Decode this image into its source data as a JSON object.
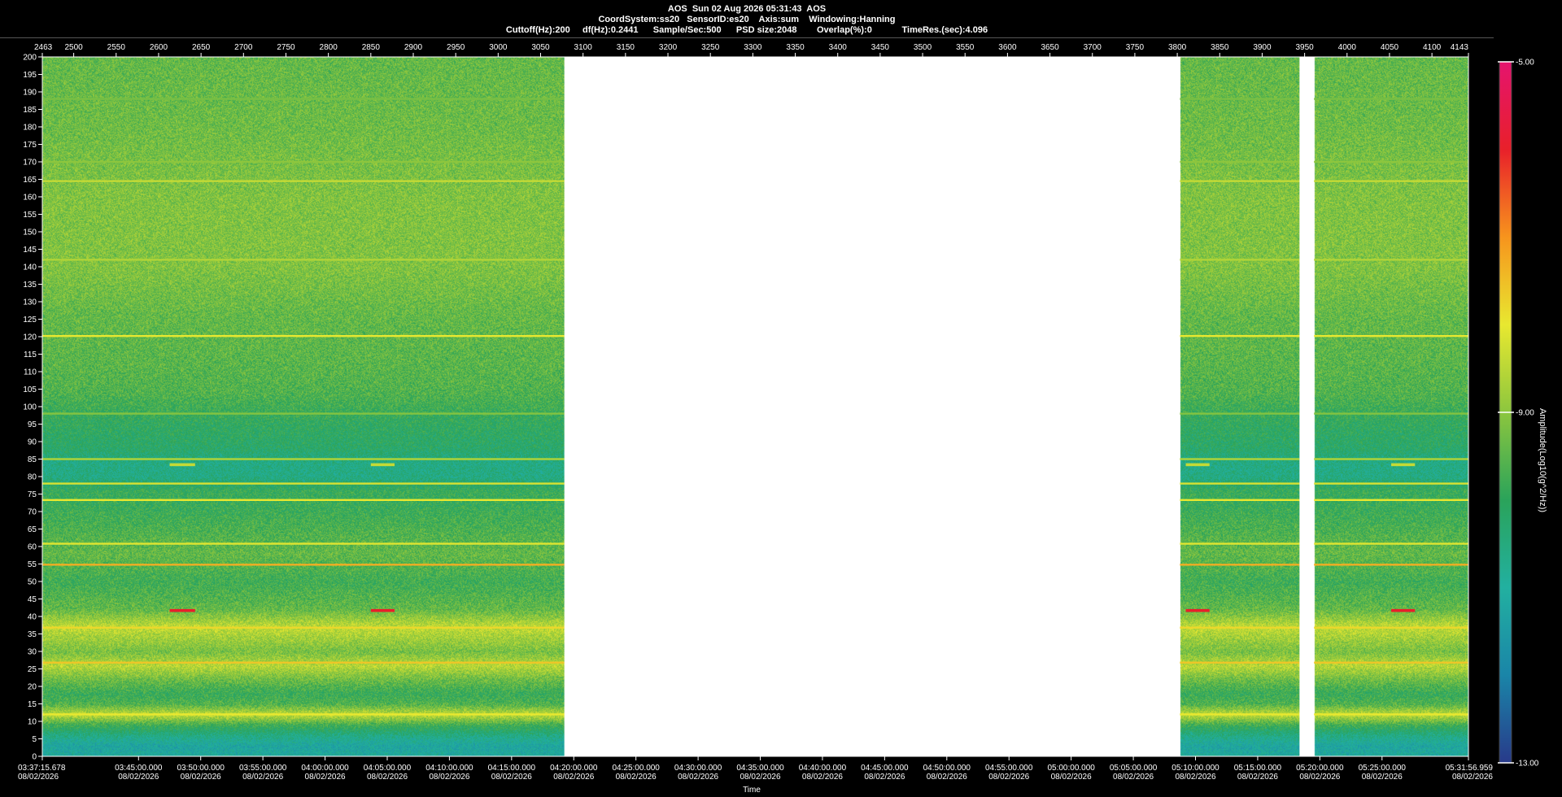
{
  "header": {
    "line1": "AOS  Sun 02 Aug 2026 05:31:43  AOS",
    "line2": "CoordSystem:ss20   SensorID:es20    Axis:sum    Windowing:Hanning",
    "line3": "Cuttoff(Hz):200     df(Hz):0.2441      Sample/Sec:500      PSD size:2048        Overlap(%):0            TimeRes.(sec):4.096"
  },
  "colors": {
    "background": "#000000",
    "gap": "#ffffff",
    "colormap": [
      "#283a8a",
      "#1a85a8",
      "#22b0a0",
      "#2aa35a",
      "#8cc63e",
      "#e8e830",
      "#f7941d",
      "#e8202a",
      "#e5146e"
    ]
  },
  "chart_data": {
    "type": "heatmap",
    "title": "AOS  Sun 02 Aug 2026 05:31:43  AOS",
    "xlabel": "Time",
    "ylabel": "",
    "colorbar": {
      "label": "Amplitude(Log10(g^2/Hz))",
      "range": [
        -13.0,
        -5.0
      ],
      "tick_labels": [
        "-5.00",
        "-9.00",
        "-13.00"
      ]
    },
    "y_range": [
      0,
      200
    ],
    "y_ticks": [
      0,
      5,
      10,
      15,
      20,
      25,
      30,
      35,
      40,
      45,
      50,
      55,
      60,
      65,
      70,
      75,
      80,
      85,
      90,
      95,
      100,
      105,
      110,
      115,
      120,
      125,
      130,
      135,
      140,
      145,
      150,
      155,
      160,
      165,
      170,
      175,
      180,
      185,
      190,
      195,
      200
    ],
    "top_x_range": [
      2463,
      4143
    ],
    "top_x_ticks": [
      2463,
      2500,
      2550,
      2600,
      2650,
      2700,
      2750,
      2800,
      2850,
      2900,
      2950,
      3000,
      3050,
      3100,
      3150,
      3200,
      3250,
      3300,
      3350,
      3400,
      3450,
      3500,
      3550,
      3600,
      3650,
      3700,
      3750,
      3800,
      3850,
      3900,
      3950,
      4000,
      4050,
      4100,
      4143
    ],
    "time_range": [
      "03:37:15.678",
      "05:31:56.959"
    ],
    "time_ticks": [
      {
        "time": "03:37:15.678",
        "date": "08/02/2026"
      },
      {
        "time": "03:45:00.000",
        "date": "08/02/2026"
      },
      {
        "time": "03:50:00.000",
        "date": "08/02/2026"
      },
      {
        "time": "03:55:00.000",
        "date": "08/02/2026"
      },
      {
        "time": "04:00:00.000",
        "date": "08/02/2026"
      },
      {
        "time": "04:05:00.000",
        "date": "08/02/2026"
      },
      {
        "time": "04:10:00.000",
        "date": "08/02/2026"
      },
      {
        "time": "04:15:00.000",
        "date": "08/02/2026"
      },
      {
        "time": "04:20:00.000",
        "date": "08/02/2026"
      },
      {
        "time": "04:25:00.000",
        "date": "08/02/2026"
      },
      {
        "time": "04:30:00.000",
        "date": "08/02/2026"
      },
      {
        "time": "04:35:00.000",
        "date": "08/02/2026"
      },
      {
        "time": "04:40:00.000",
        "date": "08/02/2026"
      },
      {
        "time": "04:45:00.000",
        "date": "08/02/2026"
      },
      {
        "time": "04:50:00.000",
        "date": "08/02/2026"
      },
      {
        "time": "04:55:00.000",
        "date": "08/02/2026"
      },
      {
        "time": "05:00:00.000",
        "date": "08/02/2026"
      },
      {
        "time": "05:05:00.000",
        "date": "08/02/2026"
      },
      {
        "time": "05:10:00.000",
        "date": "08/02/2026"
      },
      {
        "time": "05:15:00.000",
        "date": "08/02/2026"
      },
      {
        "time": "05:20:00.000",
        "date": "08/02/2026"
      },
      {
        "time": "05:25:00.000",
        "date": "08/02/2026"
      },
      {
        "time": "05:31:56.959",
        "date": "08/02/2026"
      }
    ],
    "data_segments": [
      {
        "start": 2463,
        "end": 3078
      },
      {
        "start": 3803,
        "end": 3944
      },
      {
        "start": 3961,
        "end": 4143
      }
    ],
    "gaps": [
      {
        "start": 3078,
        "end": 3803
      },
      {
        "start": 3944,
        "end": 3961
      }
    ],
    "base_level_profile": [
      {
        "f": 0,
        "level": -11.0
      },
      {
        "f": 3,
        "level": -11.2
      },
      {
        "f": 6,
        "level": -10.6
      },
      {
        "f": 9,
        "level": -9.8
      },
      {
        "f": 12,
        "level": -8.4
      },
      {
        "f": 15,
        "level": -9.6
      },
      {
        "f": 18,
        "level": -9.9
      },
      {
        "f": 22,
        "level": -9.3
      },
      {
        "f": 26,
        "level": -8.5
      },
      {
        "f": 30,
        "level": -9.2
      },
      {
        "f": 37,
        "level": -8.4
      },
      {
        "f": 42,
        "level": -9.4
      },
      {
        "f": 50,
        "level": -9.8
      },
      {
        "f": 58,
        "level": -9.4
      },
      {
        "f": 66,
        "level": -9.7
      },
      {
        "f": 72,
        "level": -9.9
      },
      {
        "f": 76,
        "level": -9.9
      },
      {
        "f": 80,
        "level": -10.6
      },
      {
        "f": 84,
        "level": -10.6
      },
      {
        "f": 88,
        "level": -10.2
      },
      {
        "f": 96,
        "level": -10.0
      },
      {
        "f": 104,
        "level": -9.6
      },
      {
        "f": 112,
        "level": -9.5
      },
      {
        "f": 126,
        "level": -9.4
      },
      {
        "f": 140,
        "level": -9.1
      },
      {
        "f": 160,
        "level": -9.1
      },
      {
        "f": 180,
        "level": -9.3
      },
      {
        "f": 200,
        "level": -9.4
      }
    ],
    "spectral_lines": [
      {
        "f": 12,
        "level": -8.0
      },
      {
        "f": 26.8,
        "level": -7.6
      },
      {
        "f": 36.8,
        "level": -7.8
      },
      {
        "f": 54.8,
        "level": -7.3
      },
      {
        "f": 60.8,
        "level": -8.1
      },
      {
        "f": 73.3,
        "level": -8.0
      },
      {
        "f": 78,
        "level": -8.2
      },
      {
        "f": 85,
        "level": -8.6
      },
      {
        "f": 98,
        "level": -9.1
      },
      {
        "f": 120.2,
        "level": -8.0
      },
      {
        "f": 142,
        "level": -8.6
      },
      {
        "f": 164.5,
        "level": -8.4
      },
      {
        "f": 170,
        "level": -9.0
      },
      {
        "f": 188,
        "level": -9.2
      }
    ],
    "events": [
      {
        "x0": 2613,
        "x1": 2643,
        "f": 41.7,
        "level": -6.0
      },
      {
        "x0": 2613,
        "x1": 2643,
        "f": 83.4,
        "level": -8.4
      },
      {
        "x0": 2850,
        "x1": 2878,
        "f": 41.7,
        "level": -6.0
      },
      {
        "x0": 2850,
        "x1": 2878,
        "f": 83.4,
        "level": -8.4
      },
      {
        "x0": 3810,
        "x1": 3838,
        "f": 41.7,
        "level": -6.0
      },
      {
        "x0": 3810,
        "x1": 3838,
        "f": 83.4,
        "level": -8.4
      },
      {
        "x0": 4052,
        "x1": 4080,
        "f": 41.7,
        "level": -6.0
      },
      {
        "x0": 4052,
        "x1": 4080,
        "f": 83.4,
        "level": -8.4
      }
    ]
  }
}
